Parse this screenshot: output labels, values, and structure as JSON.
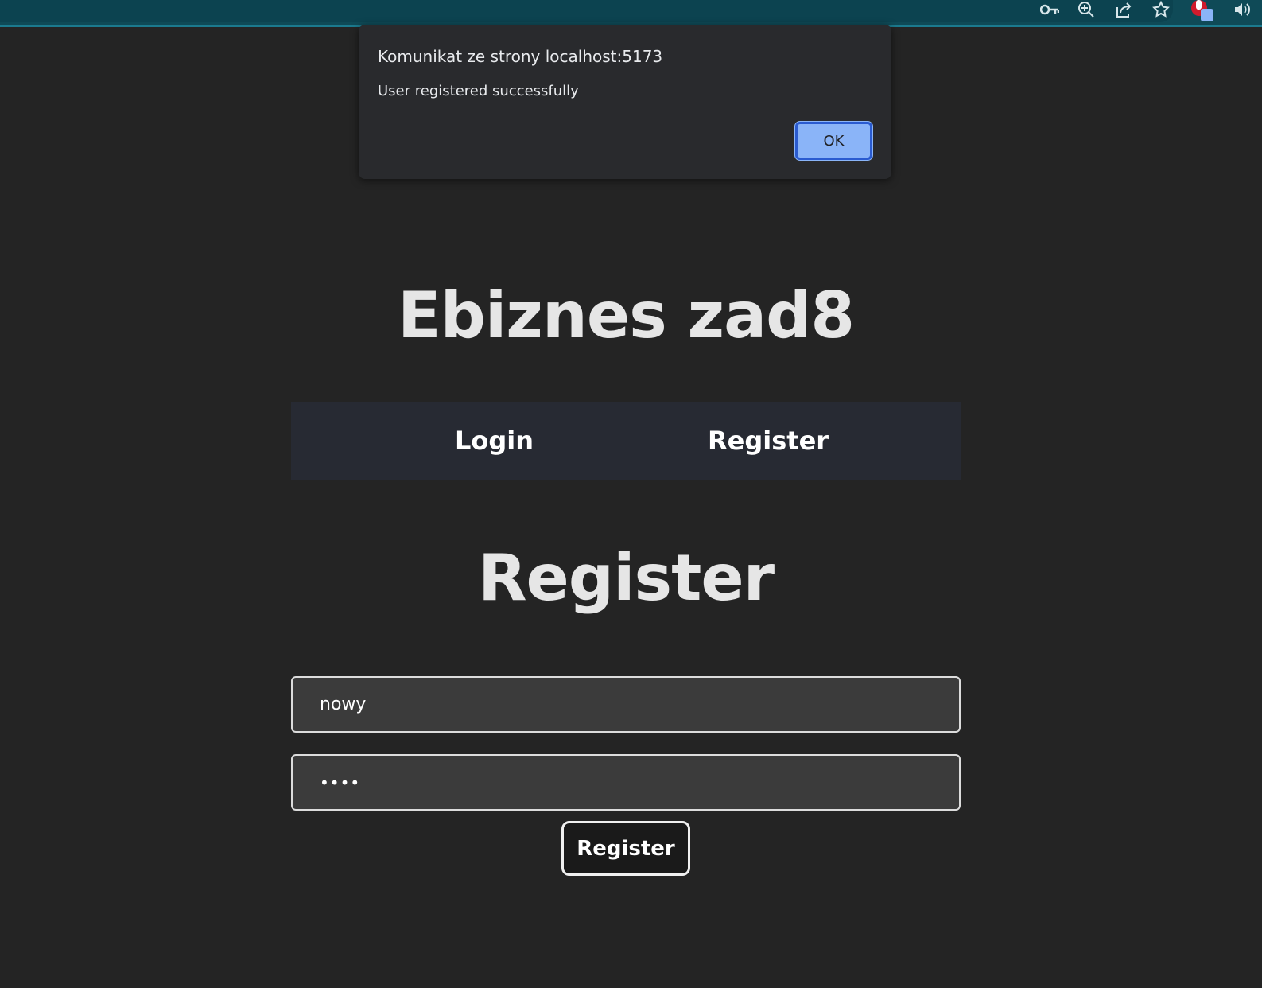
{
  "browser": {
    "toolbar_icons": [
      "key-icon",
      "zoom-icon",
      "share-icon",
      "star-icon",
      "extension-icon",
      "speaker-icon"
    ]
  },
  "dialog": {
    "title": "Komunikat ze strony localhost:5173",
    "message": "User registered successfully",
    "ok_label": "OK"
  },
  "page": {
    "app_title": "Ebiznes zad8",
    "nav": {
      "login_label": "Login",
      "register_label": "Register"
    },
    "section_title": "Register",
    "form": {
      "username_value": "nowy",
      "password_value": "••••",
      "submit_label": "Register"
    }
  },
  "colors": {
    "background": "#242424",
    "browser_bar": "#0f4a57",
    "dialog_bg": "#292a2d",
    "ok_button": "#8ab4f8",
    "nav_bg": "#272a33"
  }
}
